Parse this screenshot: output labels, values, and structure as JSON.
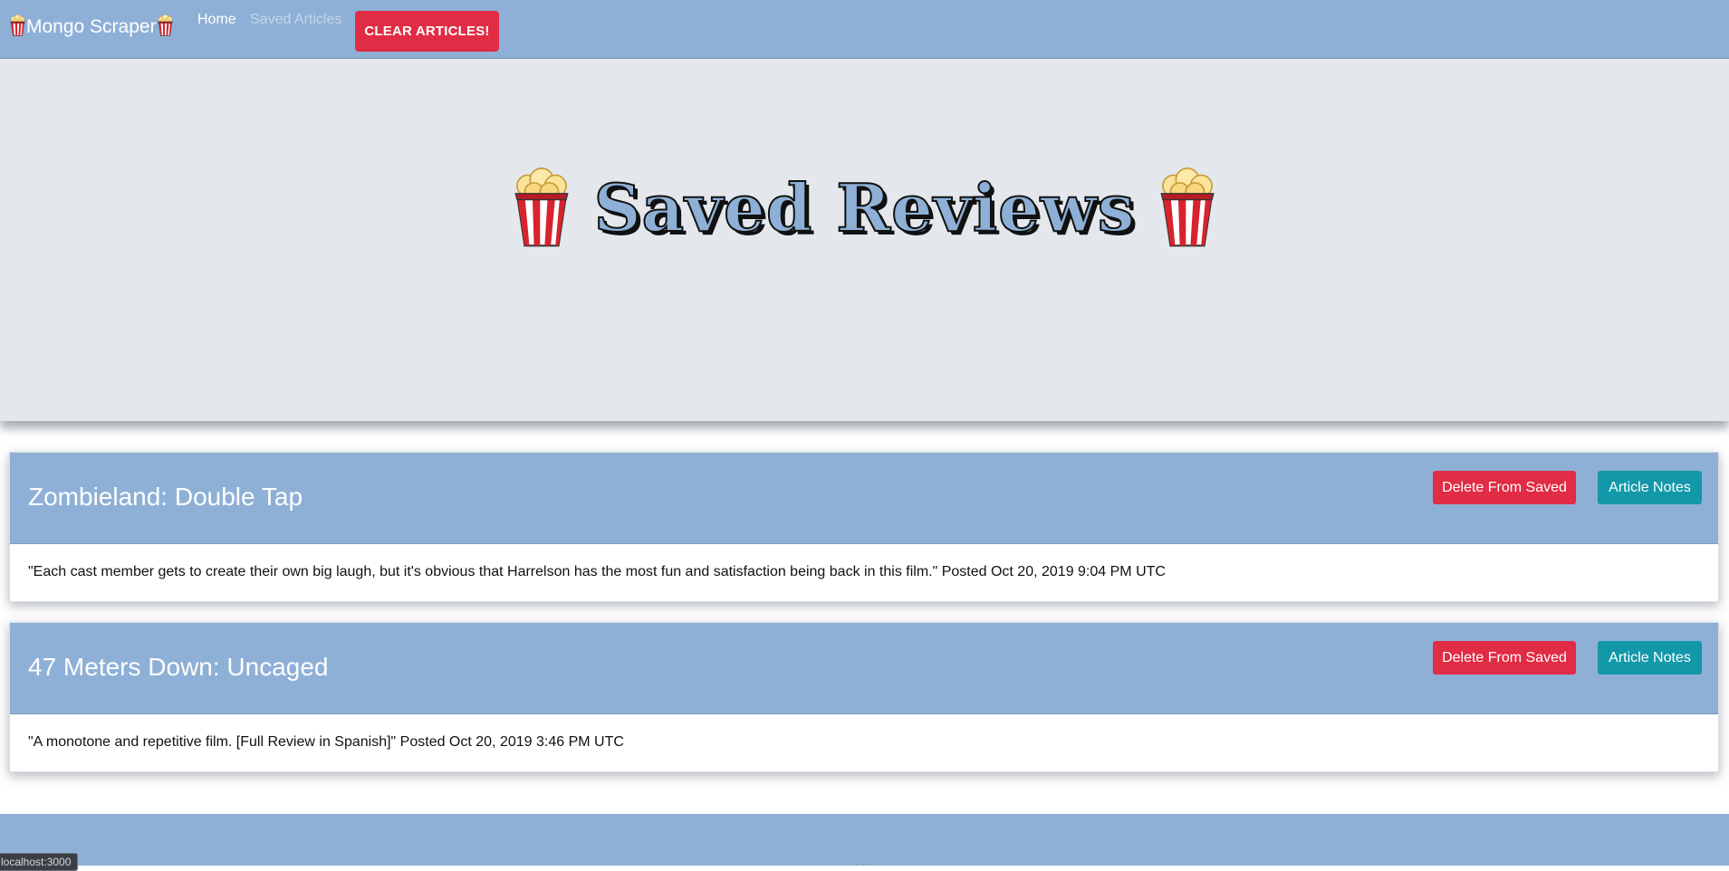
{
  "navbar": {
    "brand": "Mongo Scraper",
    "links": [
      "Home",
      "Saved Articles"
    ],
    "clear_button": "CLEAR ARTICLES!"
  },
  "hero": {
    "title": "Saved Reviews"
  },
  "articles": [
    {
      "title": "Zombieland: Double Tap",
      "summary": "\"Each cast member gets to create their own big laugh, but it's obvious that Harrelson has the most fun and satisfaction being back in this film.\" Posted Oct 20, 2019 9:04 PM UTC",
      "delete_label": "Delete From Saved",
      "notes_label": "Article Notes"
    },
    {
      "title": "47 Meters Down: Uncaged",
      "summary": "\"A monotone and repetitive film. [Full Review in Spanish]\" Posted Oct 20, 2019 3:46 PM UTC",
      "delete_label": "Delete From Saved",
      "notes_label": "Article Notes"
    }
  ],
  "status_bar": {
    "url": "localhost:3000"
  },
  "colors": {
    "navbar_bg": "#8eb0d6",
    "jumbotron_bg": "#e4e8ec",
    "danger": "#e02c44",
    "info": "#1298a8"
  },
  "icons": [
    "popcorn-icon"
  ]
}
